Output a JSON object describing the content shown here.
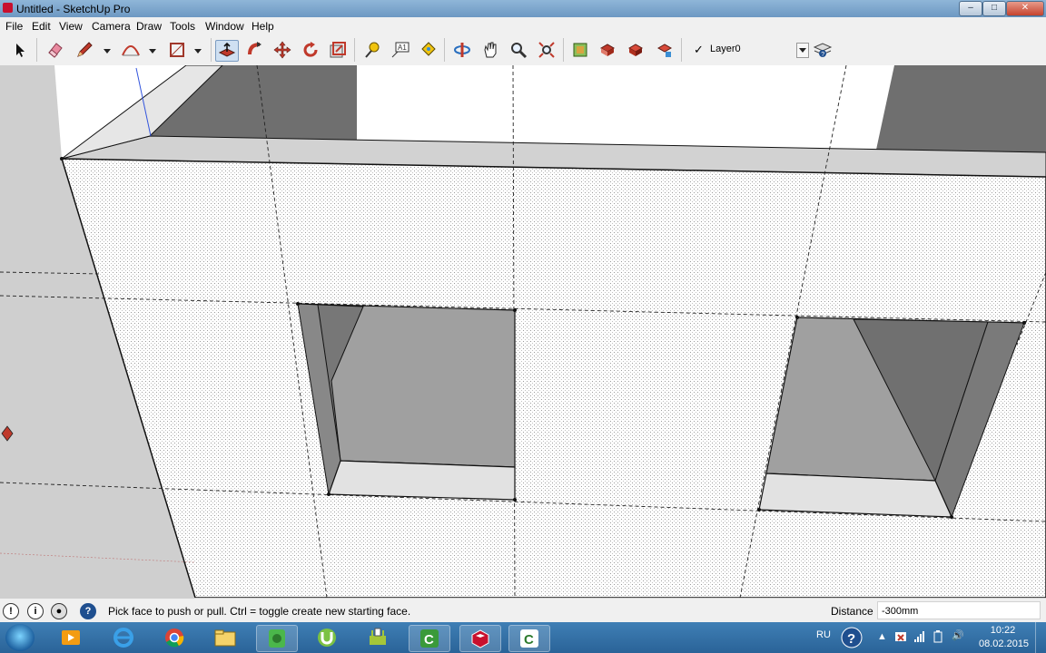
{
  "window": {
    "title": "Untitled - SketchUp Pro"
  },
  "menu": [
    "File",
    "Edit",
    "View",
    "Camera",
    "Draw",
    "Tools",
    "Window",
    "Help"
  ],
  "toolbar": {
    "tools": [
      "select-icon",
      "eraser-icon",
      "pencil-icon",
      "arc-icon",
      "rectangle-icon",
      "push-pull-icon",
      "follow-me-icon",
      "move-icon",
      "rotate-icon",
      "scale-icon",
      "tape-measure-icon",
      "text-icon",
      "paint-bucket-icon",
      "orbit-icon",
      "pan-icon",
      "zoom-icon",
      "zoom-extents-icon",
      "get-models-icon",
      "share-model-icon",
      "components-icon",
      "extension-warehouse-icon"
    ],
    "layer": "Layer0",
    "active_tool": "push-pull-icon"
  },
  "status": {
    "message": "Pick face to push or pull.  Ctrl = toggle create new starting face.",
    "distance_label": "Distance",
    "distance_value": "-300mm"
  },
  "taskbar": {
    "apps": [
      "media-player-icon",
      "internet-explorer-icon",
      "chrome-icon",
      "file-explorer-icon",
      "evernote-icon",
      "utorrent-icon",
      "android-tool-icon",
      "camtasia-icon",
      "sketchup-icon",
      "camtasia-recorder-icon"
    ],
    "language": "RU",
    "time": "10:22",
    "date": "08.02.2015"
  },
  "colors": {
    "selection_blue": "#cfe0f2",
    "sketchup_red": "#c8102e",
    "taskbar": "#2a6398"
  }
}
